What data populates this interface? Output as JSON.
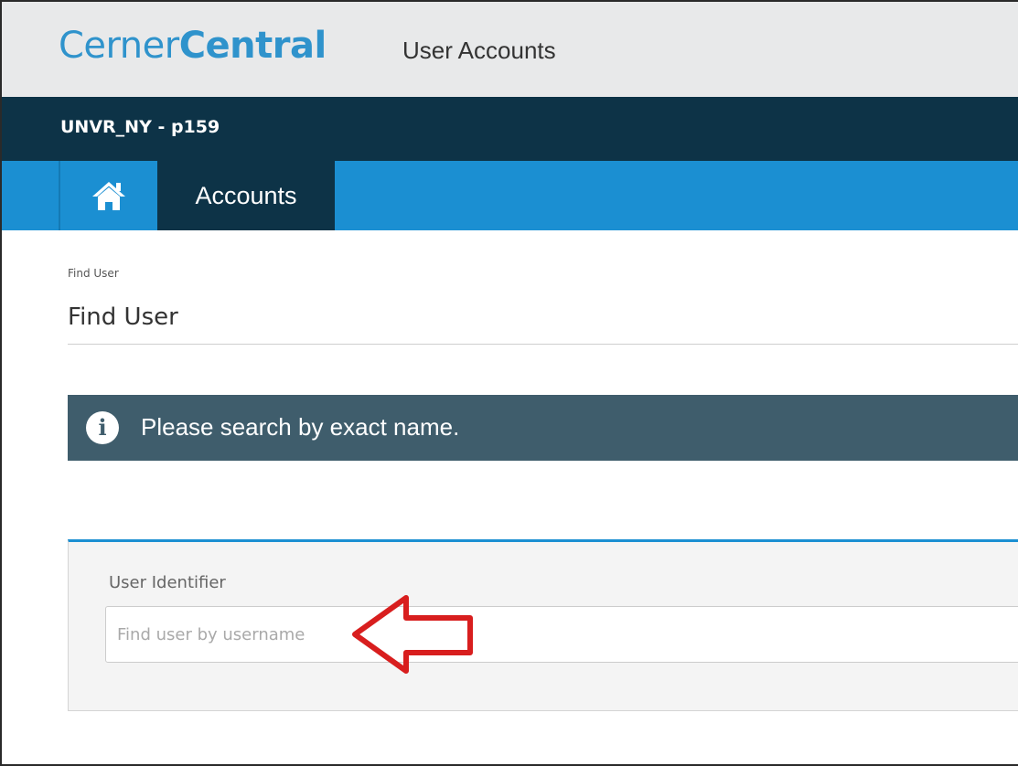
{
  "header": {
    "brand_light": "Cerner",
    "brand_bold": "Central",
    "subtitle": "User Accounts"
  },
  "tenant": {
    "label": "UNVR_NY - p159"
  },
  "nav": {
    "home_icon": "home-icon",
    "accounts_label": "Accounts"
  },
  "page": {
    "breadcrumb": "Find User",
    "title": "Find User"
  },
  "info_banner": {
    "icon": "info-icon",
    "glyph": "i",
    "message": "Please search by exact name."
  },
  "search": {
    "field_label": "User Identifier",
    "placeholder": "Find user by username",
    "value": ""
  },
  "annotation": {
    "icon": "red-arrow-icon",
    "color": "#d81e1e"
  },
  "colors": {
    "brand": "#2f93cc",
    "tenant_bar": "#0d3347",
    "nav_bar": "#1b8fd2",
    "info_banner": "#3f5d6c"
  }
}
